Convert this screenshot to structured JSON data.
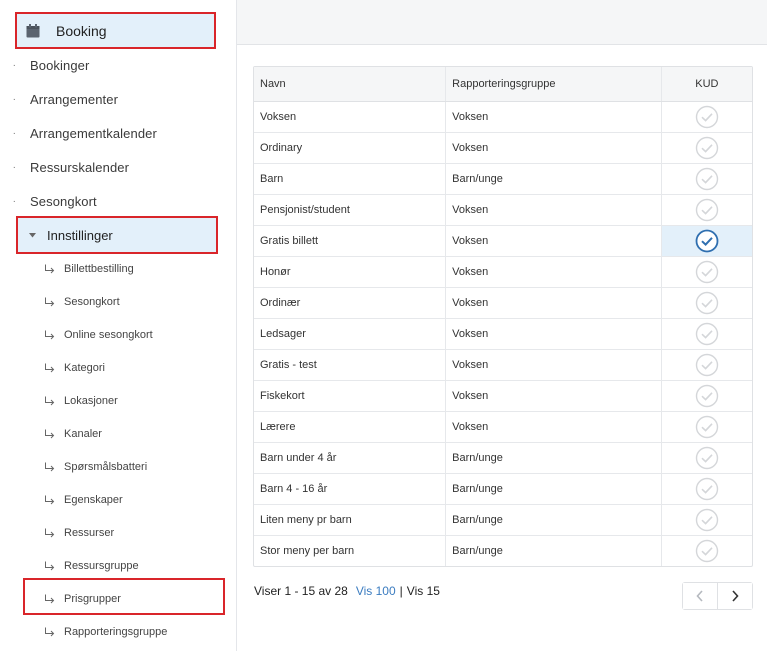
{
  "sidebar": {
    "booking_label": "Booking",
    "items": [
      {
        "label": "Bookinger"
      },
      {
        "label": "Arrangementer"
      },
      {
        "label": "Arrangementkalender"
      },
      {
        "label": "Ressurskalender"
      },
      {
        "label": "Sesongkort"
      }
    ],
    "settings_label": "Innstillinger",
    "sub_items": [
      {
        "label": "Billettbestilling"
      },
      {
        "label": "Sesongkort"
      },
      {
        "label": "Online sesongkort"
      },
      {
        "label": "Kategori"
      },
      {
        "label": "Lokasjoner"
      },
      {
        "label": "Kanaler"
      },
      {
        "label": "Spørsmålsbatteri"
      },
      {
        "label": "Egenskaper"
      },
      {
        "label": "Ressurser"
      },
      {
        "label": "Ressursgruppe"
      },
      {
        "label": "Prisgrupper"
      },
      {
        "label": "Rapporteringsgruppe"
      }
    ]
  },
  "table": {
    "headers": {
      "name": "Navn",
      "group": "Rapporteringsgruppe",
      "kud": "KUD"
    },
    "rows": [
      {
        "name": "Voksen",
        "group": "Voksen",
        "kud": false
      },
      {
        "name": "Ordinary",
        "group": "Voksen",
        "kud": false
      },
      {
        "name": "Barn",
        "group": "Barn/unge",
        "kud": false
      },
      {
        "name": "Pensjonist/student",
        "group": "Voksen",
        "kud": false
      },
      {
        "name": "Gratis billett",
        "group": "Voksen",
        "kud": true
      },
      {
        "name": "Honør",
        "group": "Voksen",
        "kud": false
      },
      {
        "name": "Ordinær",
        "group": "Voksen",
        "kud": false
      },
      {
        "name": "Ledsager",
        "group": "Voksen",
        "kud": false
      },
      {
        "name": "Gratis - test",
        "group": "Voksen",
        "kud": false
      },
      {
        "name": "Fiskekort",
        "group": "Voksen",
        "kud": false
      },
      {
        "name": "Lærere",
        "group": "Voksen",
        "kud": false
      },
      {
        "name": "Barn under 4 år",
        "group": "Barn/unge",
        "kud": false
      },
      {
        "name": "Barn 4 - 16 år",
        "group": "Barn/unge",
        "kud": false
      },
      {
        "name": "Liten meny pr barn",
        "group": "Barn/unge",
        "kud": false
      },
      {
        "name": "Stor meny per barn",
        "group": "Barn/unge",
        "kud": false
      }
    ]
  },
  "pager": {
    "status": "Viser 1 - 15 av 28",
    "show_100": "Vis 100",
    "separator": "|",
    "show_15": "Vis 15"
  },
  "colors": {
    "accent": "#3b7cc0",
    "highlight_border": "#d9252a",
    "selected_bg": "#e3f0fa"
  }
}
